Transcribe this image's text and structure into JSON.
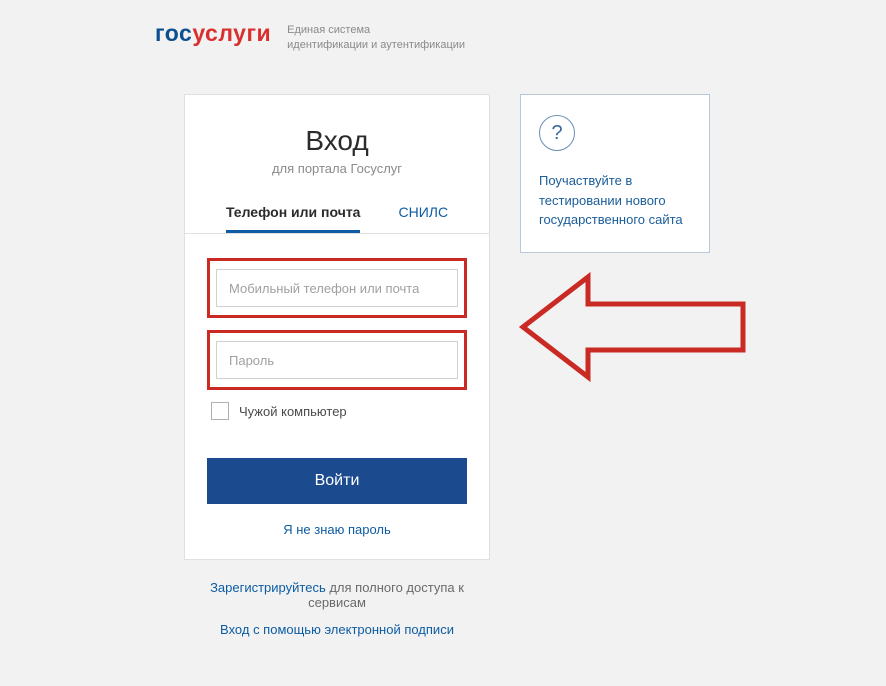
{
  "header": {
    "logo_part1": "гос",
    "logo_part2": "услуги",
    "tagline_line1": "Единая система",
    "tagline_line2": "идентификации и аутентификации"
  },
  "login": {
    "title": "Вход",
    "subtitle": "для портала Госуслуг",
    "tabs": {
      "phone_email": "Телефон или почта",
      "snils": "СНИЛС"
    },
    "login_placeholder": "Мобильный телефон или почта",
    "password_placeholder": "Пароль",
    "foreign_computer_label": "Чужой компьютер",
    "submit_label": "Войти",
    "forgot_label": "Я не знаю пароль"
  },
  "infobox": {
    "question_mark": "?",
    "text": "Поучаствуйте в тестировании нового государственного сайта"
  },
  "footer": {
    "register_link": "Зарегистрируйтесь",
    "register_rest": " для полного доступа к сервисам",
    "esign_link": "Вход с помощью электронной подписи"
  }
}
